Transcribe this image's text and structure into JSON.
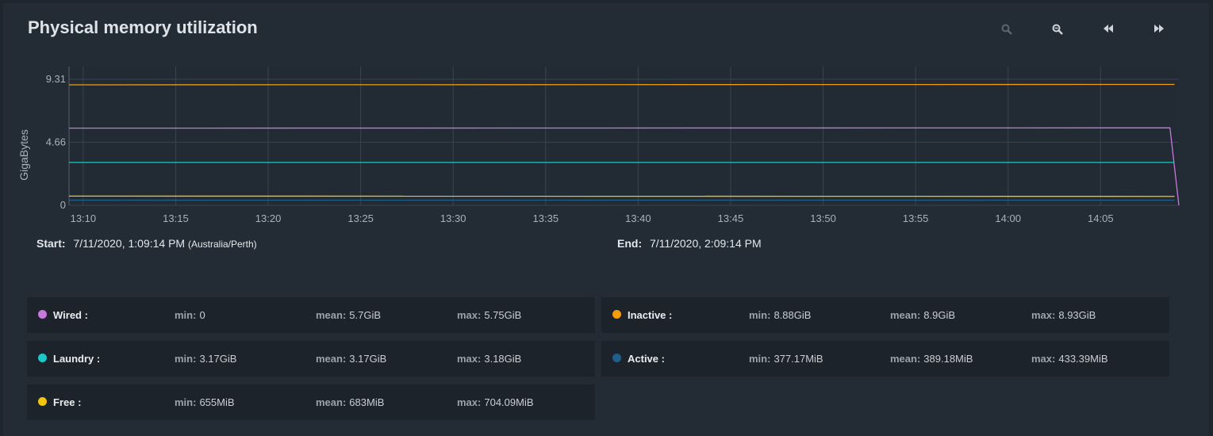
{
  "panel": {
    "title": "Physical memory utilization",
    "toolbar": [
      "zoom-in-icon",
      "zoom-out-icon",
      "rewind-icon",
      "fast-forward-icon"
    ]
  },
  "range": {
    "start_label": "Start:",
    "start_value": "7/11/2020, 1:09:14 PM",
    "timezone": "(Australia/Perth)",
    "end_label": "End:",
    "end_value": "7/11/2020, 2:09:14 PM"
  },
  "chart_data": {
    "type": "line",
    "ylabel": "GigaBytes",
    "xlabel": "",
    "x_ticks": [
      "13:10",
      "13:15",
      "13:20",
      "13:25",
      "13:30",
      "13:35",
      "13:40",
      "13:45",
      "13:50",
      "13:55",
      "14:00",
      "14:05"
    ],
    "x_range": [
      "13:09:14",
      "14:09:14"
    ],
    "y_ticks": [
      0,
      4.66,
      9.31
    ],
    "ylim": [
      0,
      9.31
    ],
    "grid": true,
    "series": [
      {
        "name": "Wired",
        "color": "#c678dd",
        "x": [
          "13:09:14",
          "14:08:45",
          "14:09:14"
        ],
        "values": [
          5.7,
          5.72,
          0
        ]
      },
      {
        "name": "Inactive",
        "color": "#f39c12",
        "x": [
          "13:09:14",
          "14:09:00"
        ],
        "values": [
          8.9,
          8.93
        ]
      },
      {
        "name": "Laundry",
        "color": "#1fc8c8",
        "x": [
          "13:09:14",
          "14:09:00"
        ],
        "values": [
          3.17,
          3.17
        ]
      },
      {
        "name": "Active",
        "color": "#1f5f8b",
        "x": [
          "13:09:14",
          "14:09:00"
        ],
        "values": [
          0.38,
          0.38
        ]
      },
      {
        "name": "Free",
        "color": "#f1c40f",
        "x": [
          "13:09:14",
          "14:09:00"
        ],
        "values": [
          0.68,
          0.66
        ]
      }
    ]
  },
  "stats_labels": {
    "min": "min:",
    "mean": "mean:",
    "max": "max:"
  },
  "stats": [
    {
      "name": "Wired :",
      "color": "#c678dd",
      "min": "0",
      "mean": "5.7GiB",
      "max": "5.75GiB"
    },
    {
      "name": "Inactive :",
      "color": "#f39c12",
      "min": "8.88GiB",
      "mean": "8.9GiB",
      "max": "8.93GiB"
    },
    {
      "name": "Laundry :",
      "color": "#1fc8c8",
      "min": "3.17GiB",
      "mean": "3.17GiB",
      "max": "3.18GiB"
    },
    {
      "name": "Active :",
      "color": "#1f5f8b",
      "min": "377.17MiB",
      "mean": "389.18MiB",
      "max": "433.39MiB"
    },
    {
      "name": "Free :",
      "color": "#f1c40f",
      "min": "655MiB",
      "mean": "683MiB",
      "max": "704.09MiB"
    }
  ]
}
